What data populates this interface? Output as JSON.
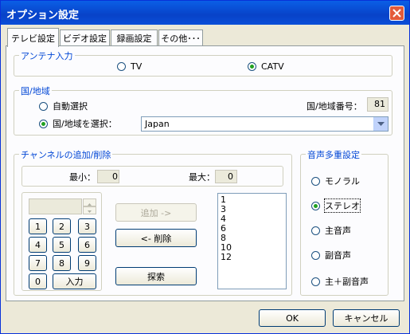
{
  "window": {
    "title": "オプション設定"
  },
  "tabs": [
    {
      "label": "テレビ設定"
    },
    {
      "label": "ビデオ設定"
    },
    {
      "label": "録画設定"
    },
    {
      "label": "その他･･･"
    }
  ],
  "antenna": {
    "title": "アンテナ入力",
    "tv": "TV",
    "catv": "CATV",
    "selected": "CATV"
  },
  "region": {
    "title": "国/地域",
    "auto": "自動選択",
    "manual": "国/地域を選択：",
    "selected": "manual",
    "number_label": "国/地域番号：",
    "number_value": "81",
    "country": "Japan"
  },
  "channel": {
    "title": "チャンネルの追加/削除",
    "min_label": "最小：",
    "min_value": "0",
    "max_label": "最大：",
    "max_value": "0",
    "keypad": [
      "1",
      "2",
      "3",
      "4",
      "5",
      "6",
      "7",
      "8",
      "9",
      "0"
    ],
    "input_label": "入力",
    "add_label": "追加 ->",
    "remove_label": "<- 削除",
    "search_label": "探索",
    "list": [
      "1",
      "3",
      "4",
      "6",
      "8",
      "10",
      "12"
    ]
  },
  "audio": {
    "title": "音声多重設定",
    "options": [
      "モノラル",
      "ステレオ",
      "主音声",
      "副音声",
      "主＋副音声"
    ],
    "selected": "ステレオ"
  },
  "footer": {
    "ok": "OK",
    "cancel": "キャンセル"
  },
  "icons": {
    "close": "close-icon",
    "dropdown": "chevron-down-icon",
    "spin_up": "spin-up-icon",
    "spin_down": "spin-down-icon"
  }
}
